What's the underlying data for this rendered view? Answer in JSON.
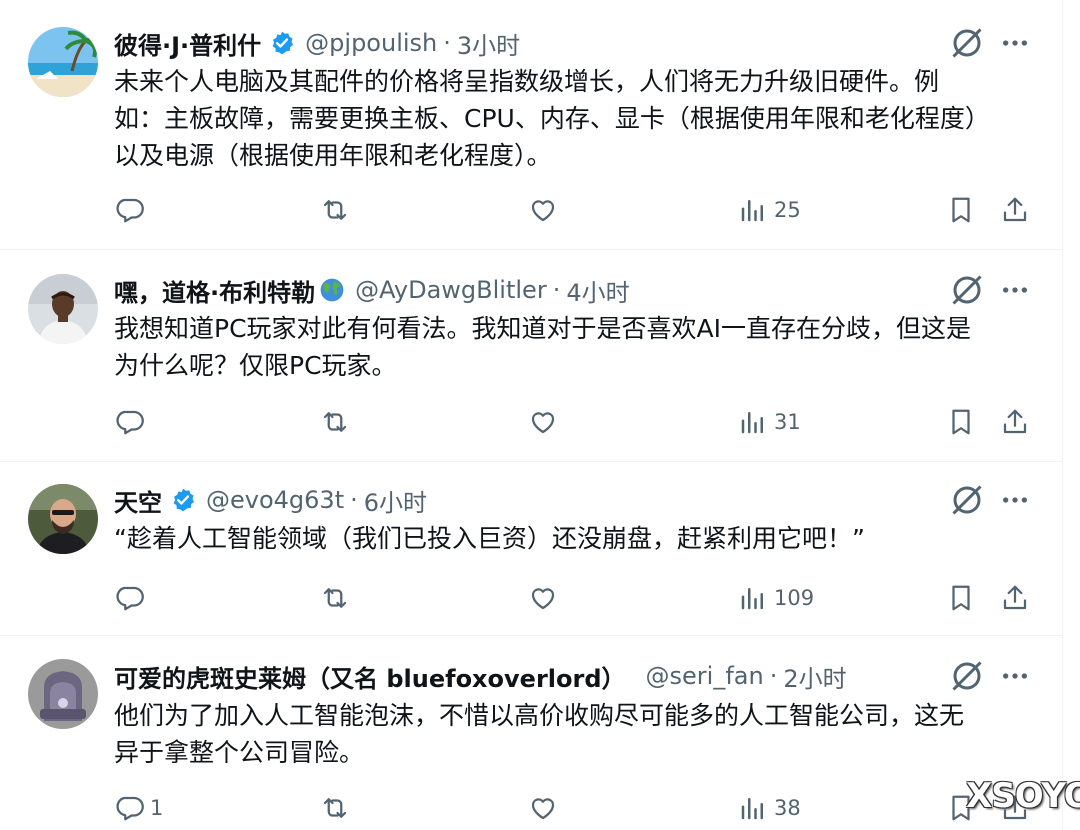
{
  "tweets": [
    {
      "name": "彼得·J·普利什",
      "handle": "@pjpoulish",
      "dot": "·",
      "time": "3小时",
      "verified": true,
      "body": "未来个人电脑及其配件的价格将呈指数级增长，人们将无力升级旧硬件。例\n如：主板故障，需要更换主板、CPU、内存、显卡（根据使用年限和老化程度）\n以及电源（根据使用年限和老化程度）。",
      "replies": "",
      "views": "25"
    },
    {
      "name": "嘿，道格·布利特勒",
      "handle": "@AyDawgBlitler",
      "dot": "·",
      "time": "4小时",
      "verified": false,
      "emoji": "globe-icon",
      "body": "我想知道PC玩家对此有何看法。我知道对于是否喜欢AI一直存在分歧，但这是\n为什么呢？仅限PC玩家。",
      "replies": "",
      "views": "31"
    },
    {
      "name": "天空",
      "handle": "@evo4g63t",
      "dot": "·",
      "time": "6小时",
      "verified": true,
      "body": "“趁着人工智能领域（我们已投入巨资）还没崩盘，赶紧利用它吧！”",
      "replies": "",
      "views": "109"
    },
    {
      "name": "可爱的虎斑史莱姆（又名 bluefoxoverlord）",
      "handle": "@seri_fan",
      "dot": "·",
      "time": "2小时",
      "verified": false,
      "body": "他们为了加入人工智能泡沫，不惜以高价收购尽可能多的人工智能公司，这无\n异于拿整个公司冒险。",
      "replies": "1",
      "views": "38"
    }
  ],
  "colors": {
    "verified": "#1d9bf0",
    "secondary": "#536471",
    "text": "#0f1419"
  },
  "icons": [
    "reply-icon",
    "retweet-icon",
    "like-icon",
    "views-icon",
    "bookmark-icon",
    "share-icon",
    "grok-icon",
    "more-icon"
  ],
  "watermark": "XSOYO"
}
